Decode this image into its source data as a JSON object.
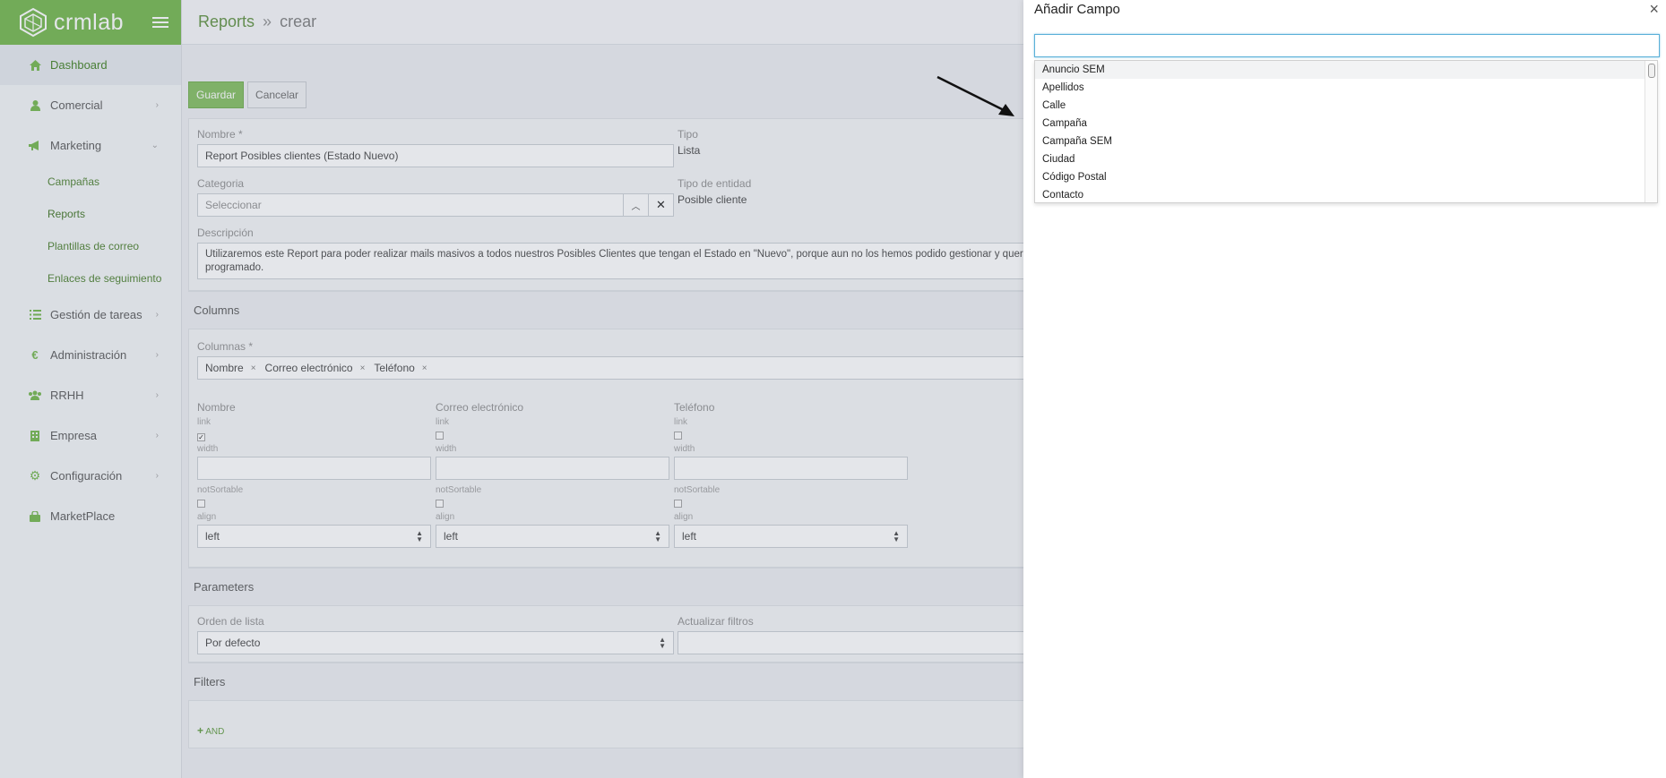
{
  "brand": {
    "name": "crmlab"
  },
  "sidebar": {
    "items": [
      {
        "label": "Dashboard",
        "icon": "home-icon",
        "active": true
      },
      {
        "label": "Comercial",
        "icon": "user-icon",
        "chevron": "›"
      },
      {
        "label": "Marketing",
        "icon": "megaphone-icon",
        "chevron": "⌄"
      },
      {
        "label": "Gestión de tareas",
        "icon": "list-icon",
        "chevron": "›"
      },
      {
        "label": "Administración",
        "icon": "euro-icon",
        "chevron": "›"
      },
      {
        "label": "RRHH",
        "icon": "people-icon",
        "chevron": "›"
      },
      {
        "label": "Empresa",
        "icon": "building-icon",
        "chevron": "›"
      },
      {
        "label": "Configuración",
        "icon": "gear-icon",
        "chevron": "›"
      },
      {
        "label": "MarketPlace",
        "icon": "bag-icon"
      }
    ],
    "marketing_sub": [
      "Campañas",
      "Reports",
      "Plantillas de correo",
      "Enlaces de seguimiento"
    ]
  },
  "header": {
    "crumb_parent": "Reports",
    "crumb_sep": "»",
    "crumb_current": "crear"
  },
  "toolbar": {
    "save_label": "Guardar",
    "cancel_label": "Cancelar"
  },
  "form": {
    "nombre_label": "Nombre *",
    "nombre_value": "Report Posibles clientes (Estado Nuevo)",
    "tipo_label": "Tipo",
    "tipo_value": "Lista",
    "categoria_label": "Categoria",
    "categoria_placeholder": "Seleccionar",
    "tipo_entidad_label": "Tipo de entidad",
    "tipo_entidad_value": "Posible cliente",
    "descripcion_label": "Descripción",
    "descripcion_line1": "Utilizaremos este Report para poder realizar mails masivos a todos nuestros Posibles Clientes que tengan el Estado en \"Nuevo\", porque aun no los hemos podido gestionar y queremos e",
    "descripcion_line2": "programado."
  },
  "columns_section": {
    "title": "Columns",
    "columnas_label": "Columnas *",
    "tags": [
      "Nombre",
      "Correo electrónico",
      "Teléfono"
    ],
    "tag_remove": "×",
    "cols": [
      {
        "name": "Nombre",
        "link_checked": true,
        "align": "left"
      },
      {
        "name": "Correo electrónico",
        "link_checked": false,
        "align": "left"
      },
      {
        "name": "Teléfono",
        "link_checked": false,
        "align": "left"
      }
    ],
    "link_label": "link",
    "width_label": "width",
    "notsortable_label": "notSortable",
    "align_label": "align"
  },
  "parameters_section": {
    "title": "Parameters",
    "orden_label": "Orden de lista",
    "orden_value": "Por defecto",
    "actualizar_label": "Actualizar filtros"
  },
  "filters_section": {
    "title": "Filters",
    "and_label": "AND"
  },
  "drawer": {
    "title": "Añadir Campo",
    "close": "×",
    "search_value": "",
    "options": [
      "Anuncio SEM",
      "Apellidos",
      "Calle",
      "Campaña",
      "Campaña SEM",
      "Ciudad",
      "Código Postal",
      "Contacto"
    ]
  },
  "colors": {
    "brand": "#7ebc59",
    "accent_green": "#6d9a50",
    "focus_blue": "#5ab0d8"
  }
}
